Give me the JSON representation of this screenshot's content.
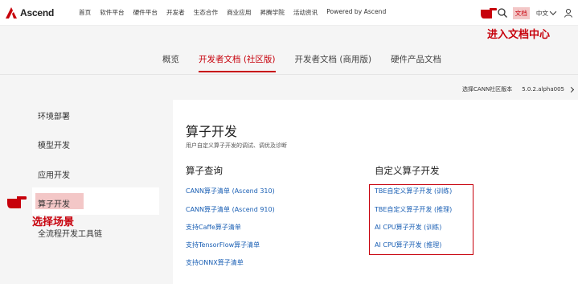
{
  "header": {
    "logo_text": "Ascend",
    "nav": [
      "首页",
      "软件平台",
      "硬件平台",
      "开发者",
      "生态合作",
      "商业应用",
      "昇腾学院",
      "活动资讯",
      "Powered by Ascend"
    ],
    "docs_link": "文档",
    "language": "中文",
    "icons": [
      "ascend-logo-icon",
      "search-icon",
      "chevron-down-icon",
      "user-icon"
    ]
  },
  "annotations": {
    "top": "进入文档中心",
    "left": "选择场景"
  },
  "tabs": [
    {
      "label": "概览",
      "active": false
    },
    {
      "label": "开发者文档 (社区版)",
      "active": true
    },
    {
      "label": "开发者文档 (商用版)",
      "active": false
    },
    {
      "label": "硬件产品文档",
      "active": false
    }
  ],
  "version": {
    "label": "选择CANN社区版本",
    "value": "5.0.2.alpha005"
  },
  "sidebar": {
    "items": [
      "环境部署",
      "模型开发",
      "应用开发",
      "算子开发",
      "全流程开发工具链"
    ],
    "active": "算子开发"
  },
  "main": {
    "title": "算子开发",
    "subtitle": "用户自定义算子开发的调试、调优及诊断",
    "col1": {
      "title": "算子查询",
      "links": [
        "CANN算子清单 (Ascend 310)",
        "CANN算子清单 (Ascend 910)",
        "支持Caffe算子清单",
        "支持TensorFlow算子清单",
        "支持ONNX算子清单"
      ]
    },
    "col2": {
      "title": "自定义算子开发",
      "links": [
        "TBE自定义算子开发 (训练)",
        "TBE自定义算子开发 (推理)",
        "AI CPU算子开发 (训练)",
        "AI CPU算子开发 (推理)"
      ]
    }
  },
  "colors": {
    "brand_red": "#c7000b",
    "highlight": "#f3c7c7",
    "link_blue": "#1a5fb4"
  }
}
